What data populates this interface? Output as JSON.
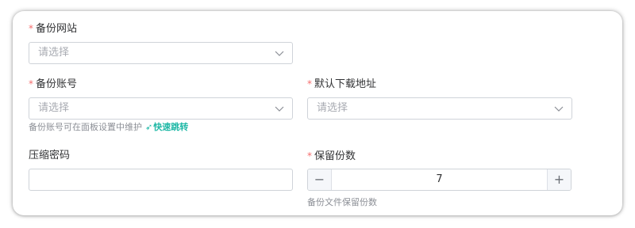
{
  "form": {
    "backup_site": {
      "label": "备份网站",
      "required_mark": "*",
      "placeholder": "请选择"
    },
    "backup_account": {
      "label": "备份账号",
      "required_mark": "*",
      "placeholder": "请选择",
      "hint_text": "备份账号可在面板设置中维护",
      "hint_link": "快速跳转"
    },
    "download_address": {
      "label": "默认下载地址",
      "required_mark": "*",
      "placeholder": "请选择"
    },
    "compress_password": {
      "label": "压缩密码",
      "value": ""
    },
    "retain_count": {
      "label": "保留份数",
      "required_mark": "*",
      "value": "7",
      "minus": "−",
      "plus": "+",
      "hint_text": "备份文件保留份数"
    }
  },
  "colors": {
    "required": "#f56c6c",
    "link": "#1fb8a6",
    "placeholder": "#a8abb2",
    "border": "#cfd3d9"
  },
  "icons": {
    "select_arrow": "chevron-down-icon",
    "jump": "send-icon"
  }
}
